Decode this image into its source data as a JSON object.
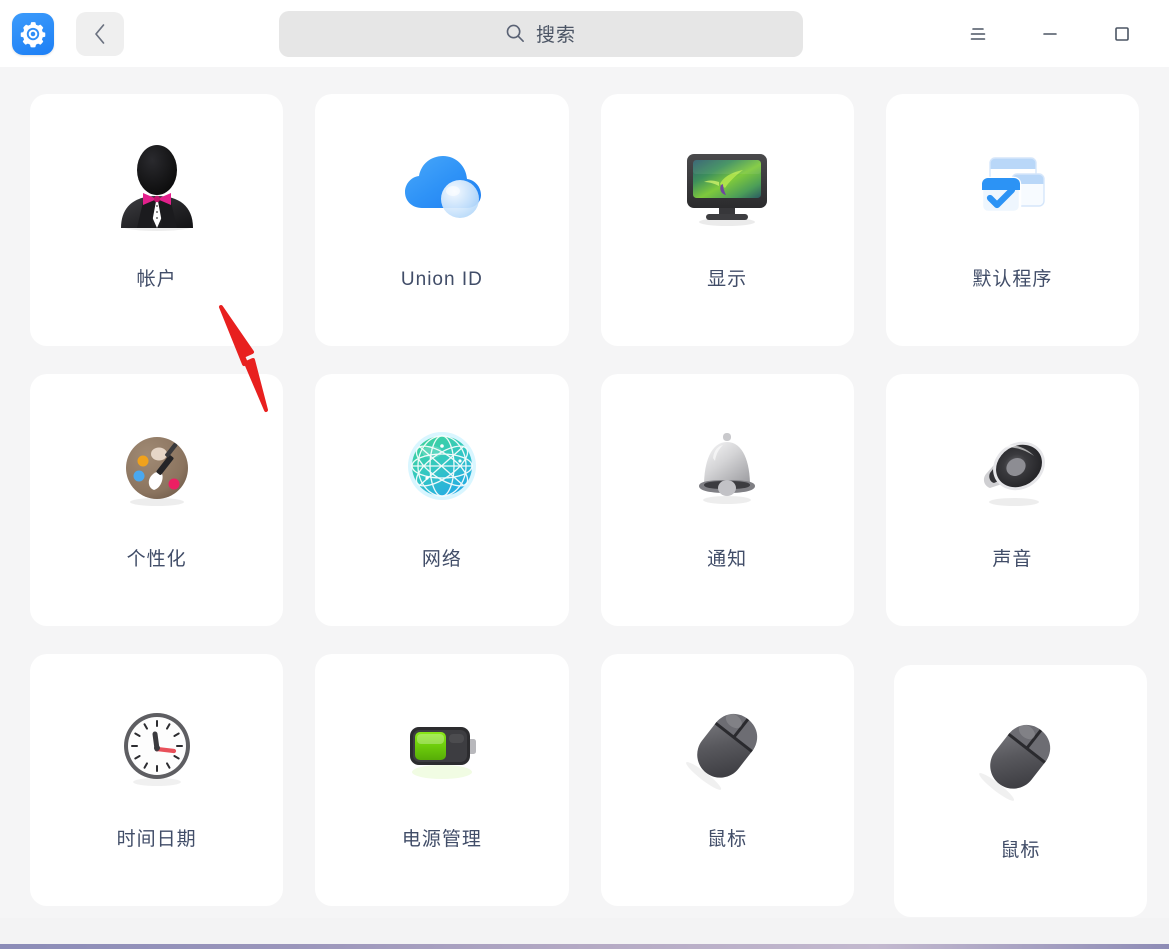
{
  "window": {
    "app_icon": "settings-gear-icon",
    "back_label": "‹",
    "back_icon": "chevron-left-icon"
  },
  "search": {
    "icon": "search-icon",
    "placeholder": "搜索",
    "value": ""
  },
  "window_controls": [
    {
      "name": "menu-button",
      "icon": "hamburger-menu-icon",
      "label": "≡"
    },
    {
      "name": "minimize-button",
      "icon": "minimize-icon",
      "label": "—"
    },
    {
      "name": "maximize-button",
      "icon": "maximize-icon",
      "label": "□"
    }
  ],
  "settings_grid": {
    "items": [
      {
        "id": "account",
        "label": "帐户",
        "icon": "user-avatar-icon"
      },
      {
        "id": "union-id",
        "label": "Union ID",
        "icon": "cloud-icon"
      },
      {
        "id": "display",
        "label": "显示",
        "icon": "monitor-icon"
      },
      {
        "id": "default-apps",
        "label": "默认程序",
        "icon": "default-programs-icon"
      },
      {
        "id": "personalization",
        "label": "个性化",
        "icon": "palette-icon"
      },
      {
        "id": "network",
        "label": "网络",
        "icon": "globe-network-icon"
      },
      {
        "id": "notification",
        "label": "通知",
        "icon": "bell-icon"
      },
      {
        "id": "sound",
        "label": "声音",
        "icon": "speaker-icon"
      },
      {
        "id": "datetime",
        "label": "时间日期",
        "icon": "clock-icon"
      },
      {
        "id": "power",
        "label": "电源管理",
        "icon": "battery-icon"
      },
      {
        "id": "mouse",
        "label": "鼠标",
        "icon": "mouse-icon"
      },
      {
        "id": "mouse-2",
        "label": "鼠标",
        "icon": "mouse-icon"
      }
    ]
  },
  "annotation": {
    "arrow_color": "#e8201f",
    "name": "red-pointer-arrow"
  },
  "colors": {
    "background": "#f5f5f6",
    "card": "#ffffff",
    "titlebar": "#ffffff",
    "label_text": "#414d68",
    "accent_blue": "#1d7ff5",
    "search_field": "#e6e6e6"
  }
}
